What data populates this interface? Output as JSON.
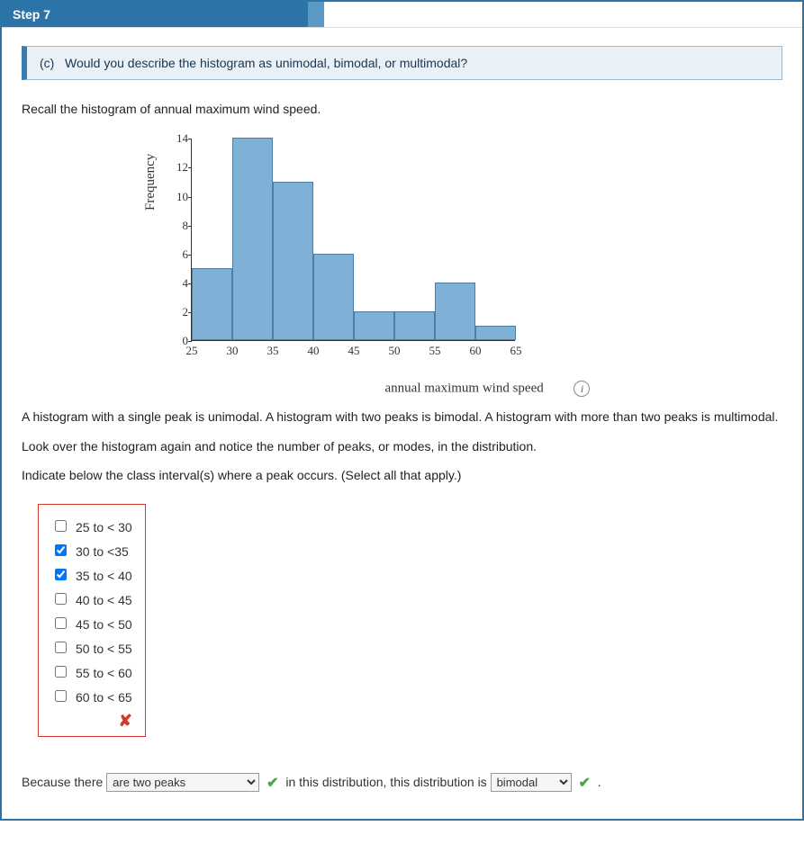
{
  "header": {
    "step_label": "Step 7"
  },
  "question": {
    "part": "(c)",
    "text": "Would you describe the histogram as unimodal, bimodal, or multimodal?"
  },
  "intro": "Recall the histogram of annual maximum wind speed.",
  "chart_data": {
    "type": "bar",
    "xlabel": "annual maximum wind speed",
    "ylabel": "Frequency",
    "ylim": [
      0,
      14
    ],
    "yticks": [
      0,
      2,
      4,
      6,
      8,
      10,
      12,
      14
    ],
    "xticks": [
      25,
      30,
      35,
      40,
      45,
      50,
      55,
      60,
      65
    ],
    "bin_width": 5,
    "categories": [
      "25–30",
      "30–35",
      "35–40",
      "40–45",
      "45–50",
      "50–55",
      "55–60",
      "60–65"
    ],
    "values": [
      5,
      14,
      11,
      6,
      2,
      2,
      4,
      1
    ]
  },
  "explain1": "A histogram with a single peak is unimodal. A histogram with two peaks is bimodal. A histogram with more than two peaks is multimodal.",
  "explain2": "Look over the histogram again and notice the number of peaks, or modes, in the distribution.",
  "prompt": "Indicate below the class interval(s) where a peak occurs. (Select all that apply.)",
  "options": [
    {
      "label": "25 to < 30",
      "checked": false
    },
    {
      "label": "30 to <35",
      "checked": true
    },
    {
      "label": "35 to < 40",
      "checked": true
    },
    {
      "label": "40 to < 45",
      "checked": false
    },
    {
      "label": "45 to < 50",
      "checked": false
    },
    {
      "label": "50 to < 55",
      "checked": false
    },
    {
      "label": "55 to < 60",
      "checked": false
    },
    {
      "label": "60 to < 65",
      "checked": false
    }
  ],
  "checkbox_feedback": "✘",
  "sentence": {
    "s1": "Because there ",
    "dd1_value": "are two peaks",
    "s2": " in this distribution, this distribution is ",
    "dd2_value": "bimodal",
    "s3": " ."
  }
}
